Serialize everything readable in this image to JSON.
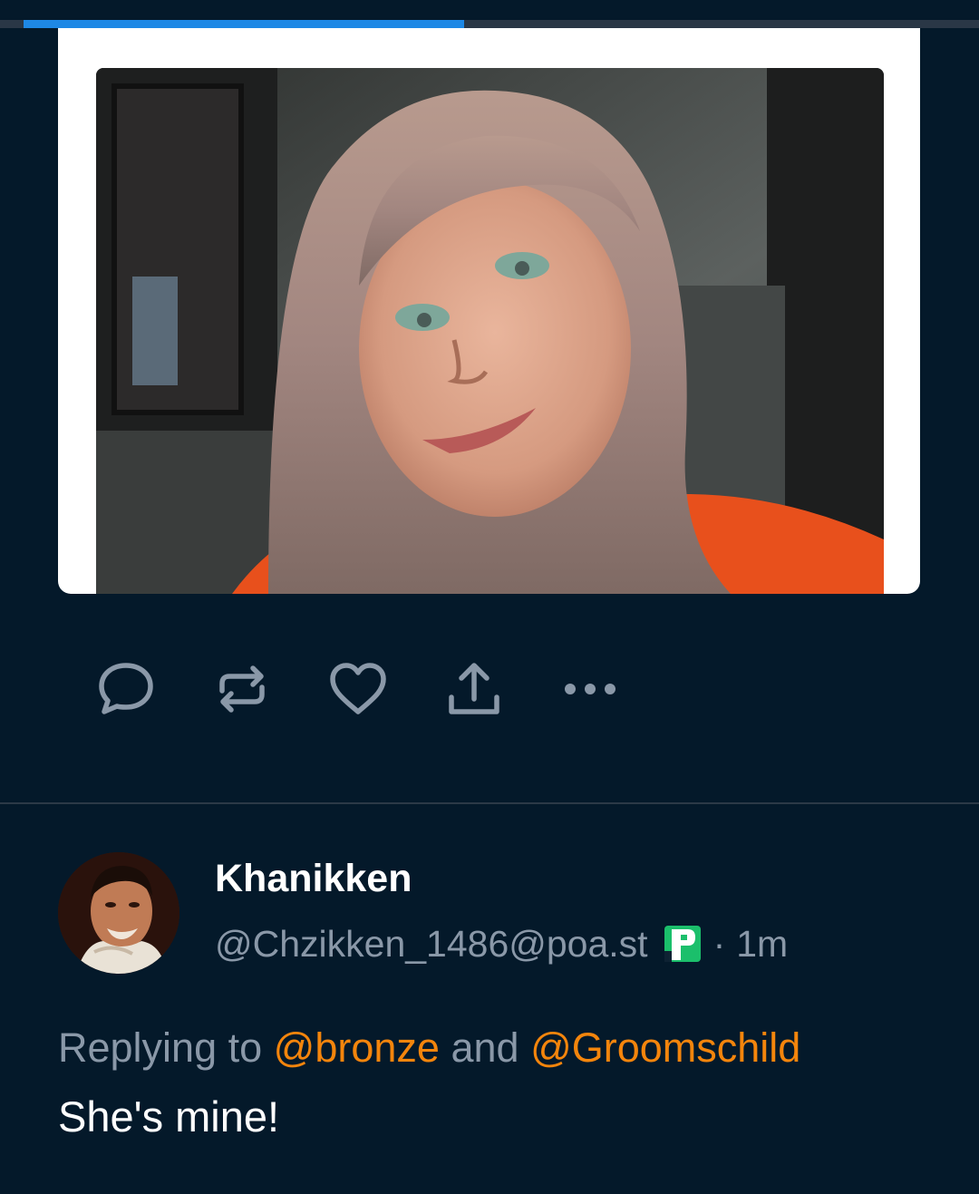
{
  "progress": {
    "fraction": 0.45,
    "color": "#1e88e5"
  },
  "media": {
    "kind": "photo"
  },
  "actions": [
    {
      "name": "reply",
      "icon": "speech-bubble-icon"
    },
    {
      "name": "repost",
      "icon": "repost-icon"
    },
    {
      "name": "like",
      "icon": "heart-icon"
    },
    {
      "name": "share",
      "icon": "share-upload-icon"
    },
    {
      "name": "more",
      "icon": "ellipsis-icon"
    }
  ],
  "reply_post": {
    "display_name": "Khanikken",
    "handle": "@Chzikken_1486@poa.st",
    "instance_badge_icon": "pleroma-badge-icon",
    "separator": "·",
    "time": "1m",
    "replying_prefix": "Replying to",
    "mentions": [
      "@bronze",
      "@Groomschild"
    ],
    "joiner": "and",
    "text": "She's mine!"
  },
  "colors": {
    "background": "#04192a",
    "muted_text": "#8a98a8",
    "mention": "#f4850c",
    "icon": "#8a98a8"
  }
}
